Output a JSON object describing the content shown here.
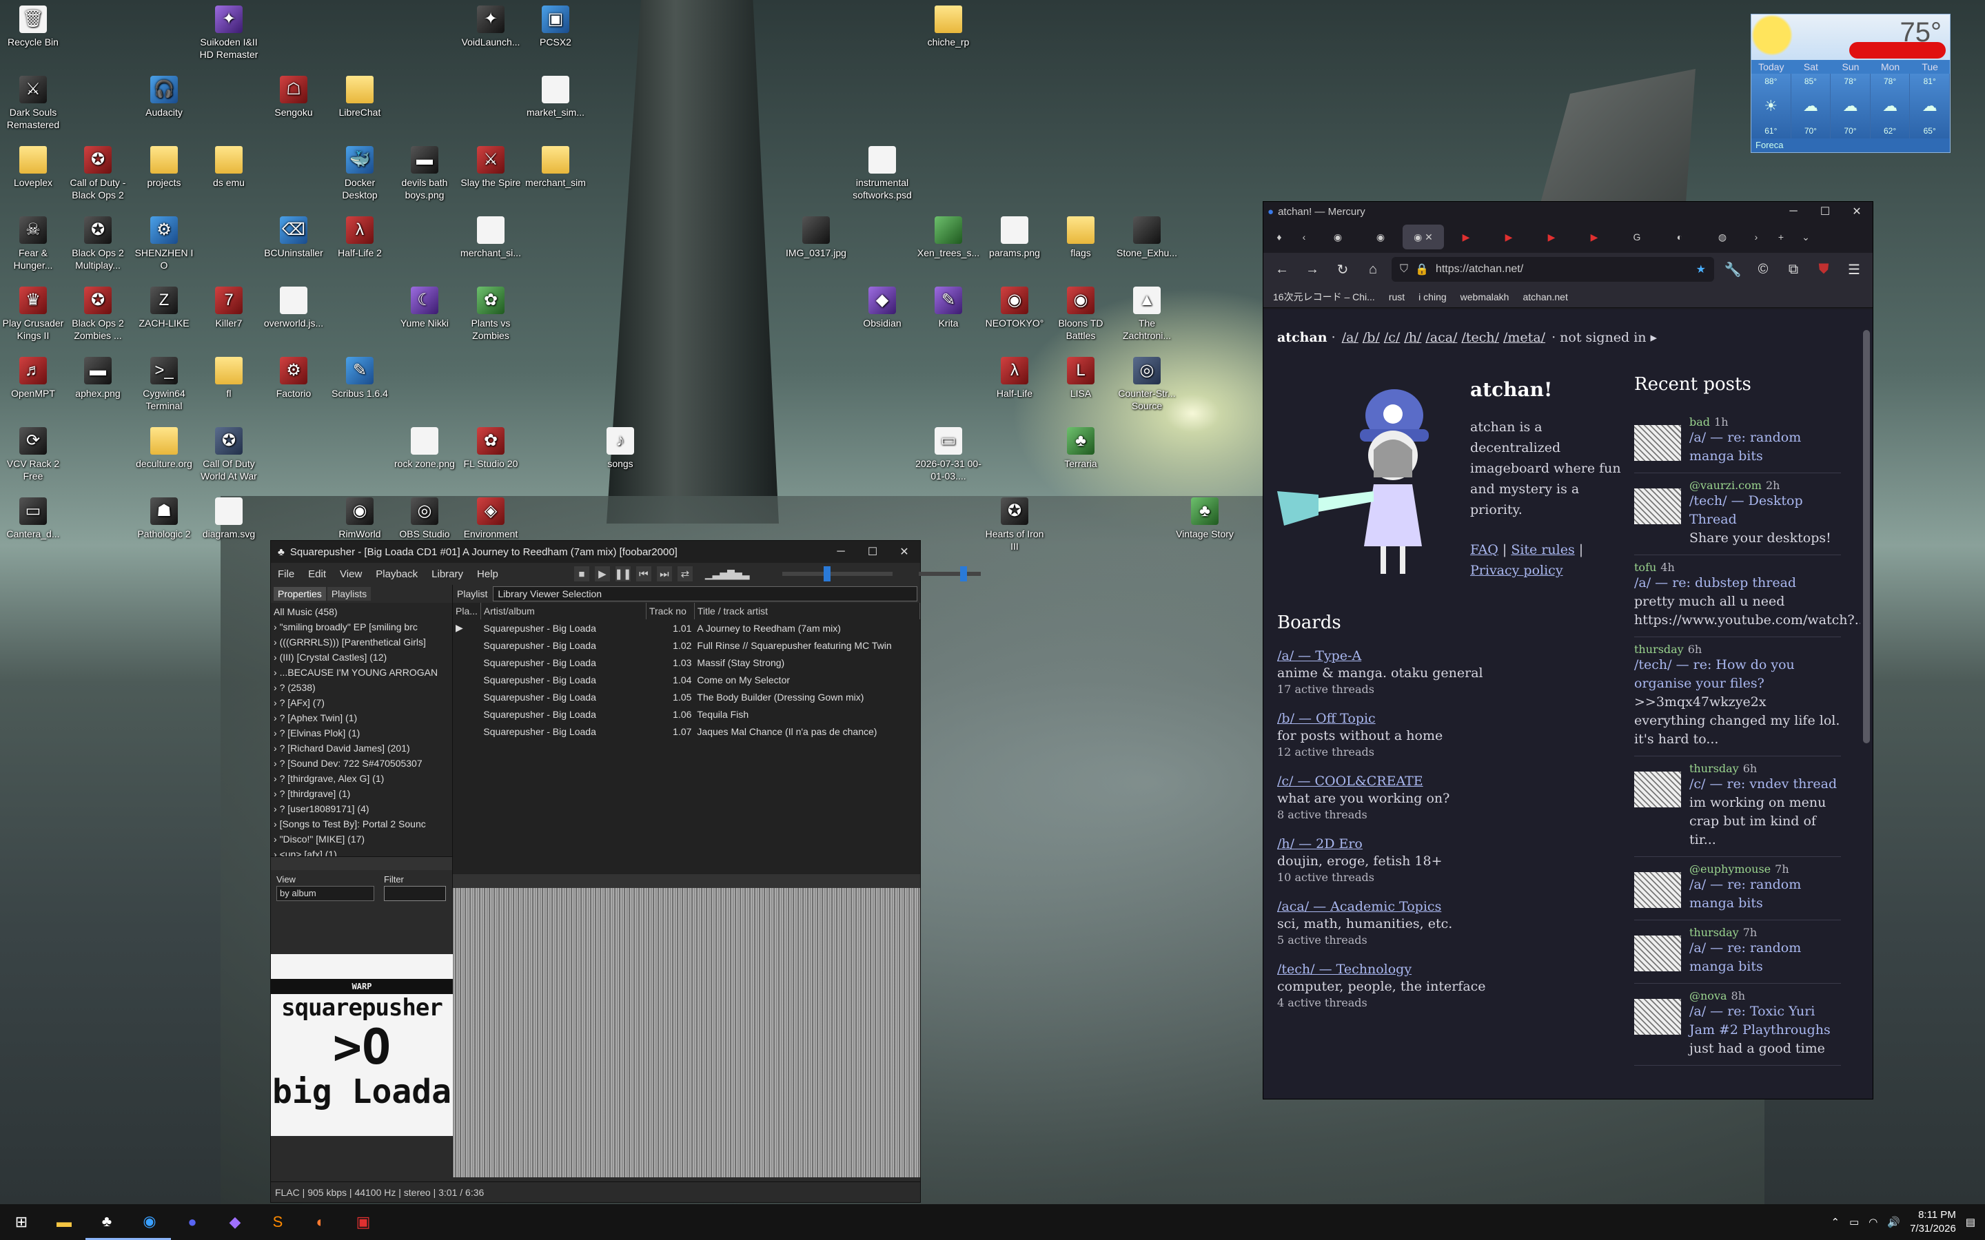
{
  "desktop_icons": [
    {
      "label": "Recycle Bin",
      "icon": "recycle-bin-icon",
      "glyph": "🗑",
      "kind": "file"
    },
    {
      "label": "Dark Souls Remastered",
      "icon": "dark-souls-icon",
      "glyph": "⚔",
      "kind": "dark"
    },
    {
      "label": "Loveplex",
      "icon": "folder-icon",
      "glyph": "",
      "kind": "folder"
    },
    {
      "label": "Fear & Hunger...",
      "icon": "fear-hunger-icon",
      "glyph": "☠",
      "kind": "dark"
    },
    {
      "label": "Play Crusader Kings II",
      "icon": "crusader-kings-icon",
      "glyph": "♛",
      "kind": "red"
    },
    {
      "label": "OpenMPT",
      "icon": "openmpt-icon",
      "glyph": "♬",
      "kind": "red"
    },
    {
      "label": "VCV Rack 2 Free",
      "icon": "vcv-rack-icon",
      "glyph": "⟳",
      "kind": "dark"
    },
    {
      "label": "Cantera_d...",
      "icon": "file-icon",
      "glyph": "▭",
      "kind": "dark"
    },
    {
      "label": "Audacity",
      "icon": "audacity-icon",
      "glyph": "🎧",
      "kind": "blue"
    },
    {
      "label": "Call of Duty - Black Ops 2",
      "icon": "cod-icon",
      "glyph": "✪",
      "kind": "red"
    },
    {
      "label": "Black Ops 2 Multiplay...",
      "icon": "black-ops-icon",
      "glyph": "✪",
      "kind": "dark"
    },
    {
      "label": "Black Ops 2 Zombies ...",
      "icon": "black-ops-zombies-icon",
      "glyph": "✪",
      "kind": "red"
    },
    {
      "label": "aphex.png",
      "icon": "image-file-icon",
      "glyph": "▬",
      "kind": "dark"
    },
    {
      "label": "deculture.org",
      "icon": "file-icon",
      "glyph": "",
      "kind": "folder"
    },
    {
      "label": "Pathologic 2",
      "icon": "pathologic-icon",
      "glyph": "☗",
      "kind": "dark"
    },
    {
      "label": "projects",
      "icon": "folder-icon",
      "glyph": "",
      "kind": "folder"
    },
    {
      "label": "SHENZHEN I O",
      "icon": "shenzhen-icon",
      "glyph": "⚙",
      "kind": "blue"
    },
    {
      "label": "ZACH-LIKE",
      "icon": "zachlike-icon",
      "glyph": "Z",
      "kind": "dark"
    },
    {
      "label": "Cygwin64 Terminal",
      "icon": "terminal-icon",
      "glyph": ">_",
      "kind": "dark"
    },
    {
      "label": "Call Of Duty World At War",
      "icon": "cod-waw-icon",
      "glyph": "✪",
      "kind": "app"
    },
    {
      "label": "diagram.svg",
      "icon": "svg-file-icon",
      "glyph": "",
      "kind": "file"
    },
    {
      "label": "Suikoden I&II HD Remaster",
      "icon": "suikoden-icon",
      "glyph": "✦",
      "kind": "purple"
    },
    {
      "label": "Sengoku",
      "icon": "sengoku-icon",
      "glyph": "☖",
      "kind": "red"
    },
    {
      "label": "ds emu",
      "icon": "folder-icon",
      "glyph": "",
      "kind": "folder"
    },
    {
      "label": "BCUninstaller",
      "icon": "uninstaller-icon",
      "glyph": "⌫",
      "kind": "blue"
    },
    {
      "label": "Killer7",
      "icon": "killer7-icon",
      "glyph": "7",
      "kind": "red"
    },
    {
      "label": "fl",
      "icon": "folder-icon",
      "glyph": "",
      "kind": "folder"
    },
    {
      "label": "overworld.js...",
      "icon": "js-file-icon",
      "glyph": "",
      "kind": "file"
    },
    {
      "label": "Factorio",
      "icon": "factorio-icon",
      "glyph": "⚙",
      "kind": "red"
    },
    {
      "label": "RimWorld",
      "icon": "rimworld-icon",
      "glyph": "◉",
      "kind": "dark"
    },
    {
      "label": "LibreChat",
      "icon": "folder-icon",
      "glyph": "",
      "kind": "folder"
    },
    {
      "label": "Docker Desktop",
      "icon": "docker-icon",
      "glyph": "🐳",
      "kind": "blue"
    },
    {
      "label": "Half-Life 2",
      "icon": "half-life-2-icon",
      "glyph": "λ",
      "kind": "red"
    },
    {
      "label": "Scribus 1.6.4",
      "icon": "scribus-icon",
      "glyph": "✎",
      "kind": "blue"
    },
    {
      "label": "Yume Nikki",
      "icon": "yume-nikki-icon",
      "glyph": "☾",
      "kind": "purple"
    },
    {
      "label": "rock zone.png",
      "icon": "image-file-icon",
      "glyph": "",
      "kind": "file"
    },
    {
      "label": "OBS Studio",
      "icon": "obs-icon",
      "glyph": "◎",
      "kind": "dark"
    },
    {
      "label": "devils bath boys.png",
      "icon": "image-file-icon",
      "glyph": "▬",
      "kind": "dark"
    },
    {
      "label": "VoidLaunch...",
      "icon": "void-launcher-icon",
      "glyph": "✦",
      "kind": "dark"
    },
    {
      "label": "Slay the Spire",
      "icon": "slay-the-spire-icon",
      "glyph": "⚔",
      "kind": "red"
    },
    {
      "label": "merchant_si...",
      "icon": "python-file-icon",
      "glyph": "",
      "kind": "file"
    },
    {
      "label": "Plants vs Zombies",
      "icon": "pvz-icon",
      "glyph": "✿",
      "kind": "green"
    },
    {
      "label": "FL Studio 20",
      "icon": "fl-studio-icon",
      "glyph": "✿",
      "kind": "red"
    },
    {
      "label": "Environment Station Alpha",
      "icon": "environment-station-icon",
      "glyph": "◈",
      "kind": "red"
    },
    {
      "label": "PCSX2",
      "icon": "pcsx2-icon",
      "glyph": "▣",
      "kind": "blue"
    },
    {
      "label": "market_sim...",
      "icon": "python-file-icon",
      "glyph": "",
      "kind": "file"
    },
    {
      "label": "merchant_sim",
      "icon": "folder-icon",
      "glyph": "",
      "kind": "folder"
    },
    {
      "label": "songs",
      "icon": "songs-file-icon",
      "glyph": "♪",
      "kind": "file"
    },
    {
      "label": "chiche_rp",
      "icon": "folder-icon",
      "glyph": "",
      "kind": "folder"
    },
    {
      "label": "instrumental softworks.psd",
      "icon": "psd-file-icon",
      "glyph": "",
      "kind": "file"
    },
    {
      "label": "IMG_0317.jpg",
      "icon": "image-file-icon",
      "glyph": "",
      "kind": "dark"
    },
    {
      "label": "Obsidian",
      "icon": "obsidian-icon",
      "glyph": "◆",
      "kind": "purple"
    },
    {
      "label": "Xen_trees_s...",
      "icon": "image-file-icon",
      "glyph": "",
      "kind": "green"
    },
    {
      "label": "Krita",
      "icon": "krita-icon",
      "glyph": "✎",
      "kind": "purple"
    },
    {
      "label": "2026-07-31 00-01-03....",
      "icon": "video-file-icon",
      "glyph": "▭",
      "kind": "file"
    },
    {
      "label": "params.png",
      "icon": "image-file-icon",
      "glyph": "",
      "kind": "file"
    },
    {
      "label": "NEOTOKYO°",
      "icon": "neotokyo-icon",
      "glyph": "◉",
      "kind": "red"
    },
    {
      "label": "Half-Life",
      "icon": "half-life-icon",
      "glyph": "λ",
      "kind": "red"
    },
    {
      "label": "Hearts of Iron III",
      "icon": "hearts-of-iron-icon",
      "glyph": "✪",
      "kind": "dark"
    },
    {
      "label": "flags",
      "icon": "folder-icon",
      "glyph": "",
      "kind": "folder"
    },
    {
      "label": "Bloons TD Battles",
      "icon": "bloons-icon",
      "glyph": "◉",
      "kind": "red"
    },
    {
      "label": "LISA",
      "icon": "lisa-icon",
      "glyph": "L",
      "kind": "red"
    },
    {
      "label": "Terraria",
      "icon": "terraria-icon",
      "glyph": "♣",
      "kind": "green"
    },
    {
      "label": "Stone_Exhu...",
      "icon": "image-file-icon",
      "glyph": "",
      "kind": "dark"
    },
    {
      "label": "The Zachtroni...",
      "icon": "zachtronics-icon",
      "glyph": "▲",
      "kind": "file"
    },
    {
      "label": "Counter-Str... Source",
      "icon": "counter-strike-icon",
      "glyph": "◎",
      "kind": "app"
    },
    {
      "label": "Vintage Story",
      "icon": "vintage-story-icon",
      "glyph": "♣",
      "kind": "green"
    }
  ],
  "weather": {
    "temp": "75°",
    "days": [
      "Today",
      "Sat",
      "Sun",
      "Mon",
      "Tue"
    ],
    "highs": [
      "88°",
      "85°",
      "78°",
      "78°",
      "81°"
    ],
    "lows": [
      "61°",
      "70°",
      "70°",
      "62°",
      "65°"
    ],
    "brand": "Foreca"
  },
  "foobar": {
    "title": "Squarepusher - [Big Loada CD1 #01] A Journey to Reedham (7am mix) [foobar2000]",
    "menu": [
      "File",
      "Edit",
      "View",
      "Playback",
      "Library",
      "Help"
    ],
    "left_tabs": [
      "Properties",
      "Playlists"
    ],
    "tree": [
      "All Music (458)",
      "\"smiling broadly\" EP [smiling brc",
      "(((GRRRLS))) [Parenthetical Girls]",
      "(III) [Crystal Castles] (12)",
      "...BECAUSE I'M YOUNG ARROGAN",
      "? (2538)",
      "? [AFx] (7)",
      "? [Aphex Twin] (1)",
      "? [Elvinas Plok] (1)",
      "? [Richard David James] (201)",
      "? [Sound Dev: 722 S#470505307",
      "? [thirdgrave, Alex G] (1)",
      "? [thirdgrave] (1)",
      "? [user18089171] (4)",
      "[Songs to Test By]: Portal 2 Sounc",
      "\"Disco!\" [MIKE] (17)",
      "<un> [afx] (1)"
    ],
    "view_label": "View",
    "view_value": "by album",
    "filter_label": "Filter",
    "playlist_label": "Playlist",
    "playlist_value": "Library Viewer Selection",
    "columns": [
      "Pla...",
      "Artist/album",
      "Track no",
      "Title / track artist"
    ],
    "tracks": [
      {
        "playing": "▶",
        "artist": "Squarepusher - Big Loada",
        "no": "1.01",
        "title": "A Journey to Reedham (7am mix)"
      },
      {
        "playing": "",
        "artist": "Squarepusher - Big Loada",
        "no": "1.02",
        "title": "Full Rinse // Squarepusher featuring MC Twin"
      },
      {
        "playing": "",
        "artist": "Squarepusher - Big Loada",
        "no": "1.03",
        "title": "Massif (Stay Strong)"
      },
      {
        "playing": "",
        "artist": "Squarepusher - Big Loada",
        "no": "1.04",
        "title": "Come on My Selector"
      },
      {
        "playing": "",
        "artist": "Squarepusher - Big Loada",
        "no": "1.05",
        "title": "The Body Builder (Dressing Gown mix)"
      },
      {
        "playing": "",
        "artist": "Squarepusher - Big Loada",
        "no": "1.06",
        "title": "Tequila Fish"
      },
      {
        "playing": "",
        "artist": "Squarepusher - Big Loada",
        "no": "1.07",
        "title": "Jaques Mal Chance (Il n'a pas de chance)"
      }
    ],
    "art": {
      "top": "WARP",
      "line1": "squarepusher",
      "line2": ">O",
      "line3": "big Loada"
    },
    "status": "FLAC | 905 kbps | 44100 Hz | stereo | 3:01 / 6:36"
  },
  "browser": {
    "window_title": "atchan! — Mercury",
    "url": "https://atchan.net/",
    "bookmarks": [
      "16次元レコード – Chi...",
      "rust",
      "i ching",
      "webmalakh",
      "atchan.net"
    ],
    "nav": {
      "site": "atchan",
      "links": [
        "/a/",
        "/b/",
        "/c/",
        "/h/",
        "/aca/",
        "/tech/",
        "/meta/"
      ],
      "status": "· not signed in ▸"
    },
    "intro": {
      "title": "atchan!",
      "text": "atchan is a decentralized imageboard where fun and mystery is a priority.",
      "faq": "FAQ",
      "rules": "Site rules",
      "privacy": "Privacy policy"
    },
    "boards_heading": "Boards",
    "boards": [
      {
        "name": "/a/ — Type-A",
        "desc": "anime & manga. otaku general",
        "count": "17 active threads"
      },
      {
        "name": "/b/ — Off Topic",
        "desc": "for posts without a home",
        "count": "12 active threads"
      },
      {
        "name": "/c/ — COOL&CREATE",
        "desc": "what are you working on?",
        "count": "8 active threads"
      },
      {
        "name": "/h/ — 2D Ero",
        "desc": "doujin, eroge, fetish 18+",
        "count": "10 active threads"
      },
      {
        "name": "/aca/ — Academic Topics",
        "desc": "sci, math, humanities, etc.",
        "count": "5 active threads"
      },
      {
        "name": "/tech/ — Technology",
        "desc": "computer, people, the interface",
        "count": "4 active threads"
      }
    ],
    "recent_heading": "Recent posts",
    "recent": [
      {
        "user": "bad",
        "ago": "1h",
        "title": "/a/ — re: random manga bits",
        "text": "",
        "thumb": true
      },
      {
        "user": "@vaurzi.com",
        "ago": "2h",
        "title": "/tech/ — Desktop Thread",
        "text": "Share your desktops!",
        "thumb": true
      },
      {
        "user": "tofu",
        "ago": "4h",
        "title": "/a/ — re: dubstep thread",
        "text": "pretty much all u need https://www.youtube.com/watch?...",
        "thumb": false
      },
      {
        "user": "thursday",
        "ago": "6h",
        "title": "/tech/ — re: How do you organise your files?",
        "text": ">>3mqx47wkzye2x everything changed my life lol. it's hard to...",
        "thumb": false
      },
      {
        "user": "thursday",
        "ago": "6h",
        "title": "/c/ — re: vndev thread",
        "text": "im working on menu crap but im kind of tir...",
        "thumb": true
      },
      {
        "user": "@euphymouse",
        "ago": "7h",
        "title": "/a/ — re: random manga bits",
        "text": "",
        "thumb": true
      },
      {
        "user": "thursday",
        "ago": "7h",
        "title": "/a/ — re: random manga bits",
        "text": "",
        "thumb": true
      },
      {
        "user": "@nova",
        "ago": "8h",
        "title": "/a/ — re: Toxic Yuri Jam #2 Playthroughs",
        "text": "just had a good time",
        "thumb": true
      }
    ]
  },
  "taskbar": {
    "apps": [
      "start-icon",
      "file-explorer-icon",
      "foobar-icon",
      "mercury-browser-icon",
      "discord-icon",
      "obsidian-icon",
      "sublime-icon",
      "firefox-icon",
      "terminal-icon"
    ],
    "time": "8:11 PM",
    "date": "7/31/2026"
  }
}
